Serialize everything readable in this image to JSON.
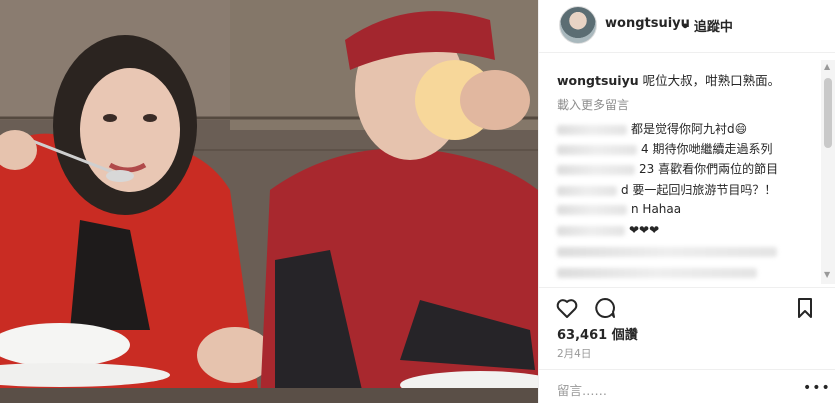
{
  "post": {
    "username": "wongtsuiyu",
    "follow_label": "追蹤中",
    "caption_user": "wongtsuiyu",
    "caption_text": "呢位大叔，咁熟口熟面。",
    "load_more": "載入更多留言",
    "comments": [
      "都是觉得你阿九衬d😄",
      "4 期待你哋繼續走過系列",
      "23 喜歡看你們兩位的節目",
      "d 要一起回归旅游节目吗？！",
      "n Hahaa",
      "❤❤❤"
    ],
    "likes": "63,461 個讚",
    "date": "2月4日",
    "comment_placeholder": "留言……",
    "more_icon_text": "•••"
  },
  "icons": {
    "heart": "heart-icon",
    "comment": "comment-icon",
    "bookmark": "bookmark-icon",
    "more": "more-icon"
  },
  "colors": {
    "text": "#262626",
    "muted": "#8e8e8e",
    "border": "#efefef"
  }
}
